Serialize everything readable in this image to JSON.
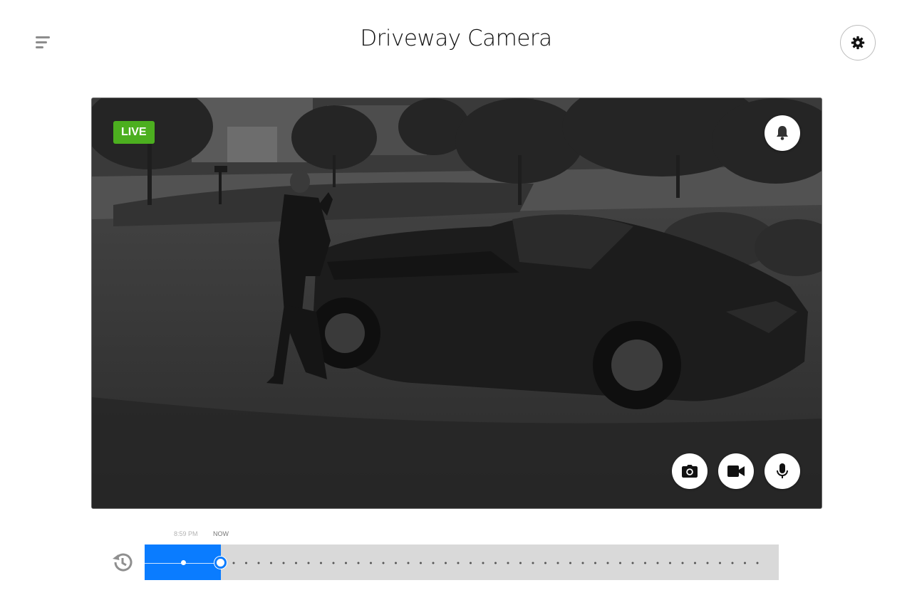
{
  "header": {
    "title": "Driveway Camera",
    "menu_icon": "menu-icon",
    "settings_icon": "gear-icon"
  },
  "video": {
    "live_label": "LIVE",
    "accent_live": "#4caf1f",
    "buttons": {
      "alerts": "bell-icon",
      "snapshot": "camera-icon",
      "record": "video-camera-icon",
      "talk": "microphone-icon"
    }
  },
  "timeline": {
    "past_label": "8:59 PM",
    "now_label": "NOW",
    "history_icon": "history-icon",
    "accent": "#0a7cff",
    "played_fraction": 0.118
  }
}
